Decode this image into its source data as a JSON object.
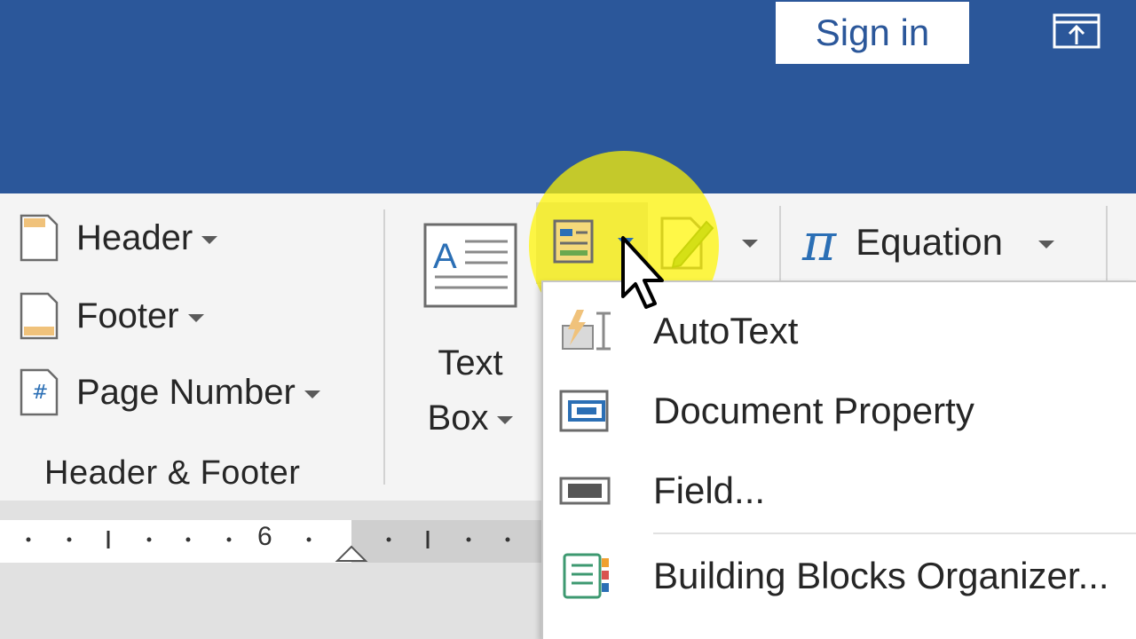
{
  "titlebar": {
    "signin_label": "Sign in",
    "share_icon": "share-icon",
    "bg_color": "#2b579a"
  },
  "ribbon": {
    "header_footer": {
      "items": [
        {
          "label": "Header",
          "icon": "header-page-icon"
        },
        {
          "label": "Footer",
          "icon": "footer-page-icon"
        },
        {
          "label": "Page Number",
          "icon": "page-number-icon"
        }
      ],
      "group_label": "Header & Footer"
    },
    "text": {
      "textbox_line1": "Text",
      "textbox_line2": "Box",
      "quick_parts_icon": "quick-parts-icon",
      "signature_icon": "signature-line-icon"
    },
    "symbols": {
      "equation_label": "Equation",
      "equation_icon": "pi-icon"
    }
  },
  "ruler": {
    "number_label": "6"
  },
  "quick_parts_menu": {
    "items": [
      {
        "label": "AutoText",
        "icon": "autotext-icon"
      },
      {
        "label": "Document Property",
        "icon": "document-property-icon"
      },
      {
        "label": "Field...",
        "icon": "field-icon"
      },
      {
        "label": "Building Blocks Organizer...",
        "icon": "building-blocks-icon"
      }
    ]
  },
  "colors": {
    "accent_blue": "#2b579a",
    "highlight_yellow": "#fff500"
  }
}
